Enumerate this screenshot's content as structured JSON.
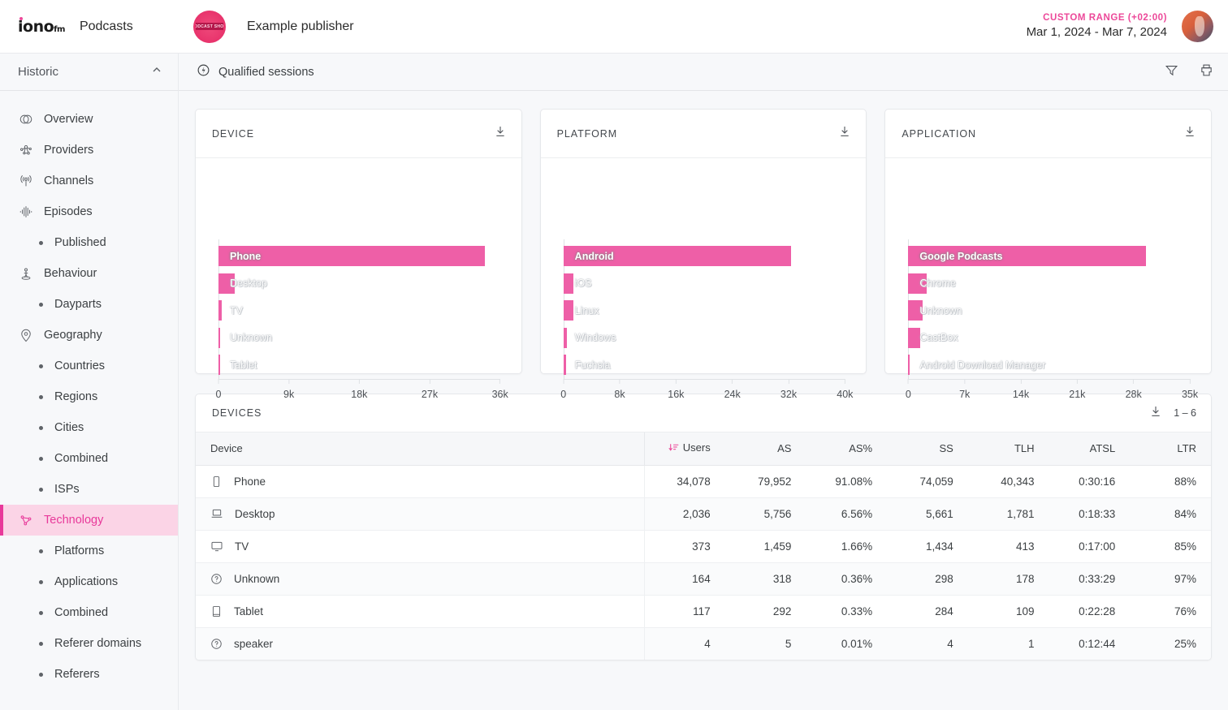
{
  "topbar": {
    "logo_text": "iono",
    "logo_suffix": "fm",
    "section": "Podcasts",
    "publisher_name": "Example publisher",
    "publisher_avatar_text": "PODCAST SHOW",
    "range_label": "CUSTOM RANGE (+02:00)",
    "range_value": "Mar 1, 2024 - Mar 7, 2024"
  },
  "sidebar": {
    "header": "Historic",
    "collapse_icon": "chevron-up-icon",
    "items": [
      {
        "label": "Overview",
        "icon": "overview-icon",
        "type": "main",
        "active": false
      },
      {
        "label": "Providers",
        "icon": "providers-icon",
        "type": "main",
        "active": false
      },
      {
        "label": "Channels",
        "icon": "channels-icon",
        "type": "main",
        "active": false
      },
      {
        "label": "Episodes",
        "icon": "episodes-icon",
        "type": "main",
        "active": false
      },
      {
        "label": "Published",
        "icon": "bullet",
        "type": "sub",
        "active": false
      },
      {
        "label": "Behaviour",
        "icon": "behaviour-icon",
        "type": "main",
        "active": false
      },
      {
        "label": "Dayparts",
        "icon": "bullet",
        "type": "sub",
        "active": false
      },
      {
        "label": "Geography",
        "icon": "geography-icon",
        "type": "main",
        "active": false
      },
      {
        "label": "Countries",
        "icon": "bullet",
        "type": "sub",
        "active": false
      },
      {
        "label": "Regions",
        "icon": "bullet",
        "type": "sub",
        "active": false
      },
      {
        "label": "Cities",
        "icon": "bullet",
        "type": "sub",
        "active": false
      },
      {
        "label": "Combined",
        "icon": "bullet",
        "type": "sub",
        "active": false
      },
      {
        "label": "ISPs",
        "icon": "bullet",
        "type": "sub",
        "active": false
      },
      {
        "label": "Technology",
        "icon": "technology-icon",
        "type": "main",
        "active": true
      },
      {
        "label": "Platforms",
        "icon": "bullet",
        "type": "sub",
        "active": false
      },
      {
        "label": "Applications",
        "icon": "bullet",
        "type": "sub",
        "active": false
      },
      {
        "label": "Combined",
        "icon": "bullet",
        "type": "sub",
        "active": false
      },
      {
        "label": "Referer domains",
        "icon": "bullet",
        "type": "sub",
        "active": false
      },
      {
        "label": "Referers",
        "icon": "bullet",
        "type": "sub",
        "active": false
      }
    ]
  },
  "subheader": {
    "metric_label": "Qualified sessions",
    "metric_icon": "qualified-sessions-icon",
    "filter_icon": "filter-icon",
    "print_icon": "print-icon"
  },
  "colors": {
    "accent": "#ec4899",
    "bar": "#ee5fa7",
    "active_bg": "#fbd4e6"
  },
  "chart_data": [
    {
      "type": "bar",
      "title": "DEVICE",
      "orientation": "horizontal",
      "categories": [
        "Phone",
        "Desktop",
        "TV",
        "Unknown",
        "Tablet"
      ],
      "values": [
        34078,
        2036,
        373,
        164,
        117
      ],
      "ticks": [
        "0",
        "9k",
        "18k",
        "27k",
        "36k"
      ],
      "tick_values": [
        0,
        9000,
        18000,
        27000,
        36000
      ],
      "xlim": [
        0,
        36000
      ],
      "ylabel": "",
      "xlabel": "",
      "grid": false,
      "legend": "none"
    },
    {
      "type": "bar",
      "title": "PLATFORM",
      "orientation": "horizontal",
      "categories": [
        "Android",
        "iOS",
        "Linux",
        "Windows",
        "Fuchsia"
      ],
      "values": [
        32300,
        1400,
        1400,
        500,
        400
      ],
      "ticks": [
        "0",
        "8k",
        "16k",
        "24k",
        "32k",
        "40k"
      ],
      "tick_values": [
        0,
        8000,
        16000,
        24000,
        32000,
        40000
      ],
      "xlim": [
        0,
        40000
      ],
      "ylabel": "",
      "xlabel": "",
      "grid": false,
      "legend": "none"
    },
    {
      "type": "bar",
      "title": "APPLICATION",
      "orientation": "horizontal",
      "categories": [
        "Google Podcasts",
        "Chrome",
        "Unknown",
        "CastBox",
        "Android Download Manager"
      ],
      "values": [
        29500,
        2300,
        1800,
        1500,
        200
      ],
      "ticks": [
        "0",
        "7k",
        "14k",
        "21k",
        "28k",
        "35k"
      ],
      "tick_values": [
        0,
        7000,
        14000,
        21000,
        28000,
        35000
      ],
      "xlim": [
        0,
        35000
      ],
      "ylabel": "",
      "xlabel": "",
      "grid": false,
      "legend": "none"
    }
  ],
  "download_icon": "download-icon",
  "table": {
    "title": "DEVICES",
    "download_icon": "download-icon",
    "pagination": "1 – 6",
    "sort_column": "Users",
    "sort_icon": "sort-descending-icon",
    "columns": [
      "Device",
      "Users",
      "AS",
      "AS%",
      "SS",
      "TLH",
      "ATSL",
      "LTR"
    ],
    "rows": [
      {
        "icon": "phone-icon",
        "device": "Phone",
        "users": "34,078",
        "as": "79,952",
        "as_pct": "91.08%",
        "ss": "74,059",
        "tlh": "40,343",
        "atsl": "0:30:16",
        "ltr": "88%"
      },
      {
        "icon": "laptop-icon",
        "device": "Desktop",
        "users": "2,036",
        "as": "5,756",
        "as_pct": "6.56%",
        "ss": "5,661",
        "tlh": "1,781",
        "atsl": "0:18:33",
        "ltr": "84%"
      },
      {
        "icon": "tv-icon",
        "device": "TV",
        "users": "373",
        "as": "1,459",
        "as_pct": "1.66%",
        "ss": "1,434",
        "tlh": "413",
        "atsl": "0:17:00",
        "ltr": "85%"
      },
      {
        "icon": "unknown-icon",
        "device": "Unknown",
        "users": "164",
        "as": "318",
        "as_pct": "0.36%",
        "ss": "298",
        "tlh": "178",
        "atsl": "0:33:29",
        "ltr": "97%"
      },
      {
        "icon": "tablet-icon",
        "device": "Tablet",
        "users": "117",
        "as": "292",
        "as_pct": "0.33%",
        "ss": "284",
        "tlh": "109",
        "atsl": "0:22:28",
        "ltr": "76%"
      },
      {
        "icon": "unknown-icon",
        "device": "speaker",
        "users": "4",
        "as": "5",
        "as_pct": "0.01%",
        "ss": "4",
        "tlh": "1",
        "atsl": "0:12:44",
        "ltr": "25%"
      }
    ]
  }
}
